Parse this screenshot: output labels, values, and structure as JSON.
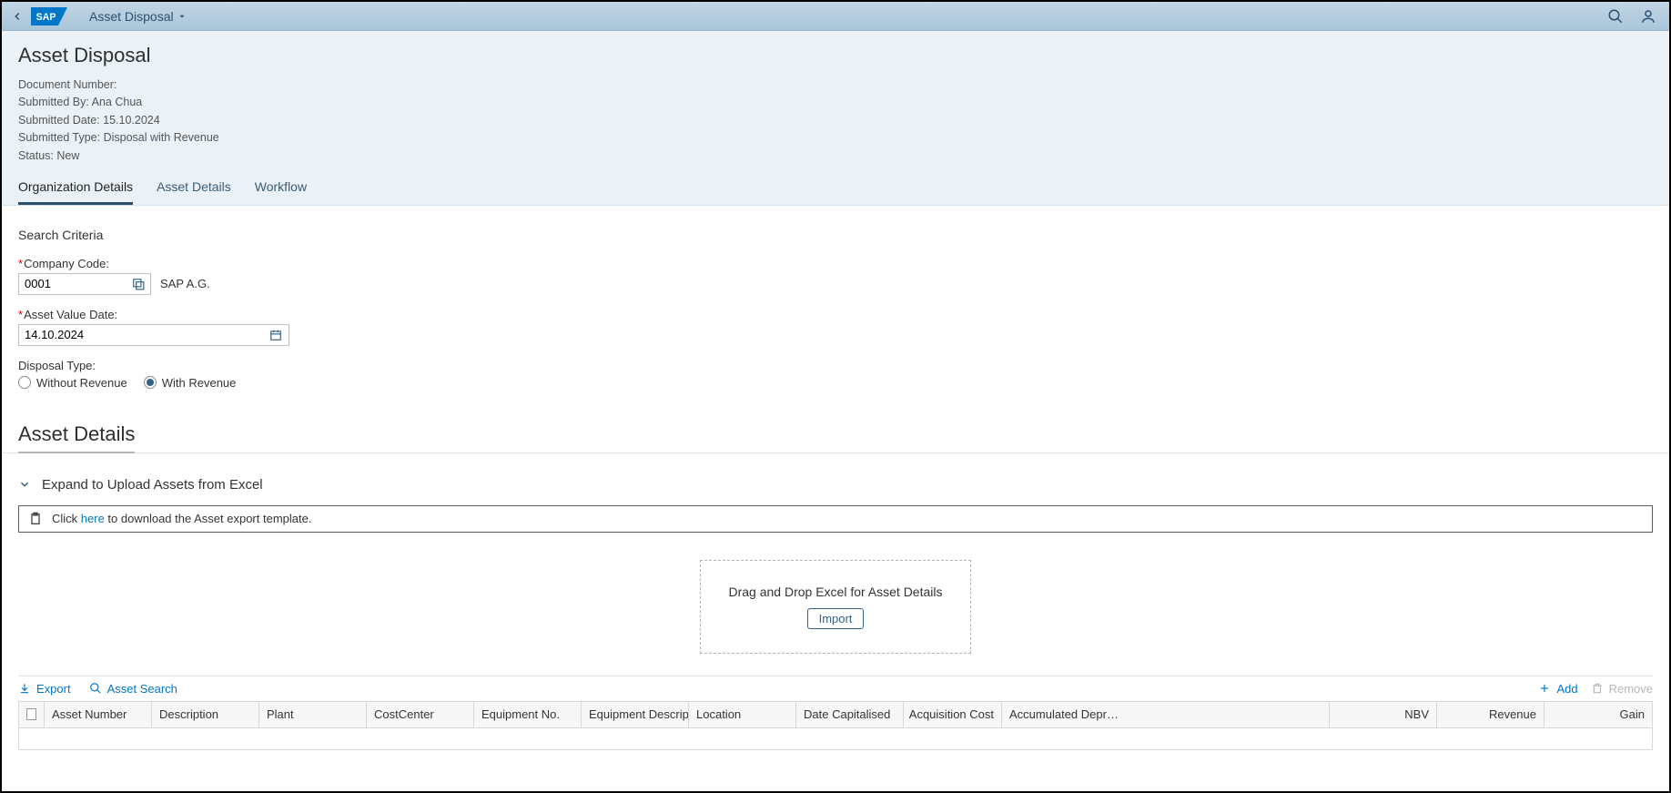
{
  "shell": {
    "title": "Asset Disposal"
  },
  "header": {
    "page_title": "Asset Disposal",
    "doc_number_label": "Document Number:",
    "doc_number_value": "",
    "submitted_by_label": "Submitted By:",
    "submitted_by_value": "Ana Chua",
    "submitted_date_label": "Submitted Date:",
    "submitted_date_value": "15.10.2024",
    "submitted_type_label": "Submitted Type:",
    "submitted_type_value": "Disposal with Revenue",
    "status_label": "Status:",
    "status_value": "New"
  },
  "tabs": [
    {
      "label": "Organization Details",
      "active": true
    },
    {
      "label": "Asset Details",
      "active": false
    },
    {
      "label": "Workflow",
      "active": false
    }
  ],
  "search": {
    "section_title": "Search Criteria",
    "company_code_label": "Company Code:",
    "company_code_value": "0001",
    "company_code_desc": "SAP A.G.",
    "asset_value_date_label": "Asset Value Date:",
    "asset_value_date_value": "14.10.2024",
    "disposal_type_label": "Disposal Type:",
    "disposal_without": "Without Revenue",
    "disposal_with": "With Revenue",
    "disposal_selected": "with"
  },
  "asset_section": {
    "title": "Asset Details",
    "expand_label": "Expand to Upload Assets from Excel",
    "info_prefix": "Click ",
    "info_link": "here",
    "info_suffix": " to download the Asset export template.",
    "drop_text": "Drag and Drop Excel for Asset Details",
    "import_btn": "Import"
  },
  "toolbar": {
    "export": "Export",
    "asset_search": "Asset Search",
    "add": "Add",
    "remove": "Remove"
  },
  "columns": {
    "asset_number": "Asset Number",
    "description": "Description",
    "plant": "Plant",
    "cost_center": "CostCenter",
    "equipment_no": "Equipment No.",
    "equipment_desc": "Equipment Descript…",
    "location": "Location",
    "date_capitalised": "Date Capitalised",
    "acquisition_cost": "Acquisition Cost",
    "accumulated_depr": "Accumulated Depr…",
    "nbv": "NBV",
    "revenue": "Revenue",
    "gain": "Gain"
  }
}
